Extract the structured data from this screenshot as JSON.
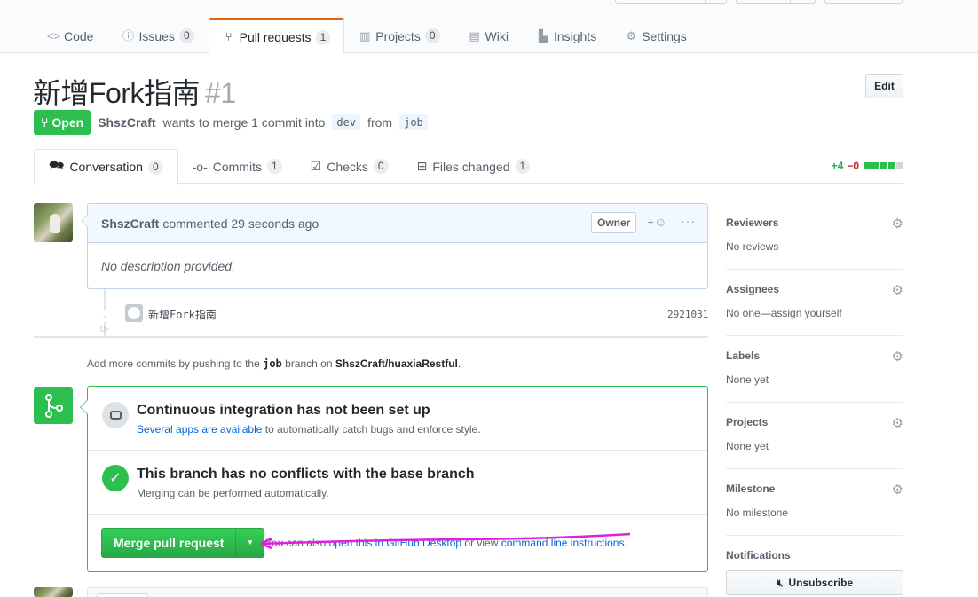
{
  "reponav": {
    "items": [
      {
        "label": "Code",
        "icon": "code-icon",
        "count": ""
      },
      {
        "label": "Issues",
        "icon": "issue-icon",
        "count": "0"
      },
      {
        "label": "Pull requests",
        "icon": "pull-request-icon",
        "count": "1"
      },
      {
        "label": "Projects",
        "icon": "project-icon",
        "count": "0"
      },
      {
        "label": "Wiki",
        "icon": "book-icon",
        "count": ""
      },
      {
        "label": "Insights",
        "icon": "graph-icon",
        "count": ""
      },
      {
        "label": "Settings",
        "icon": "gear-icon",
        "count": ""
      }
    ]
  },
  "pr": {
    "title": "新增Fork指南",
    "number": "#1",
    "edit_label": "Edit",
    "state": "Open",
    "author": "ShszCraft",
    "merge_text": "wants to merge 1 commit into",
    "base_branch": "dev",
    "from_text": "from",
    "head_branch": "job"
  },
  "tabs": [
    {
      "label": "Conversation",
      "count": "0",
      "icon": "comment-discussion-icon"
    },
    {
      "label": "Commits",
      "count": "1",
      "icon": "git-commit-icon"
    },
    {
      "label": "Checks",
      "count": "0",
      "icon": "checklist-icon"
    },
    {
      "label": "Files changed",
      "count": "1",
      "icon": "diff-icon"
    }
  ],
  "diffstat": {
    "additions": "+4",
    "deletions": "−0"
  },
  "comment": {
    "author": "ShszCraft",
    "action": "commented 29 seconds ago",
    "badge": "Owner",
    "reaction": "+☺",
    "more": "···",
    "body": "No description provided."
  },
  "commit": {
    "message": "新增Fork指南",
    "sha": "2921031"
  },
  "push_hint": {
    "prefix": "Add more commits by pushing to the",
    "branch": "job",
    "middle": "branch on",
    "repo": "ShszCraft/huaxiaRestful",
    "suffix": "."
  },
  "merge": {
    "ci_title": "Continuous integration has not been set up",
    "ci_link": "Several apps are available",
    "ci_rest": "to automatically catch bugs and enforce style.",
    "conflict_title": "This branch has no conflicts with the base branch",
    "conflict_sub": "Merging can be performed automatically.",
    "button_label": "Merge pull request",
    "alt_prefix": "You can also",
    "alt_link1": "open this in GitHub Desktop",
    "alt_middle": "or view",
    "alt_link2": "command line instructions",
    "alt_suffix": "."
  },
  "sidebar": [
    {
      "head": "Reviewers",
      "value": "No reviews"
    },
    {
      "head": "Assignees",
      "value": "No one—assign yourself"
    },
    {
      "head": "Labels",
      "value": "None yet"
    },
    {
      "head": "Projects",
      "value": "None yet"
    },
    {
      "head": "Milestone",
      "value": "No milestone"
    },
    {
      "head": "Notifications",
      "value": ""
    }
  ],
  "unsubscribe_label": "Unsubscribe",
  "colors": {
    "accent_green": "#2cbe4e",
    "link_blue": "#0366d6",
    "nav_orange": "#e36209",
    "annotation_magenta": "#e020e0"
  }
}
